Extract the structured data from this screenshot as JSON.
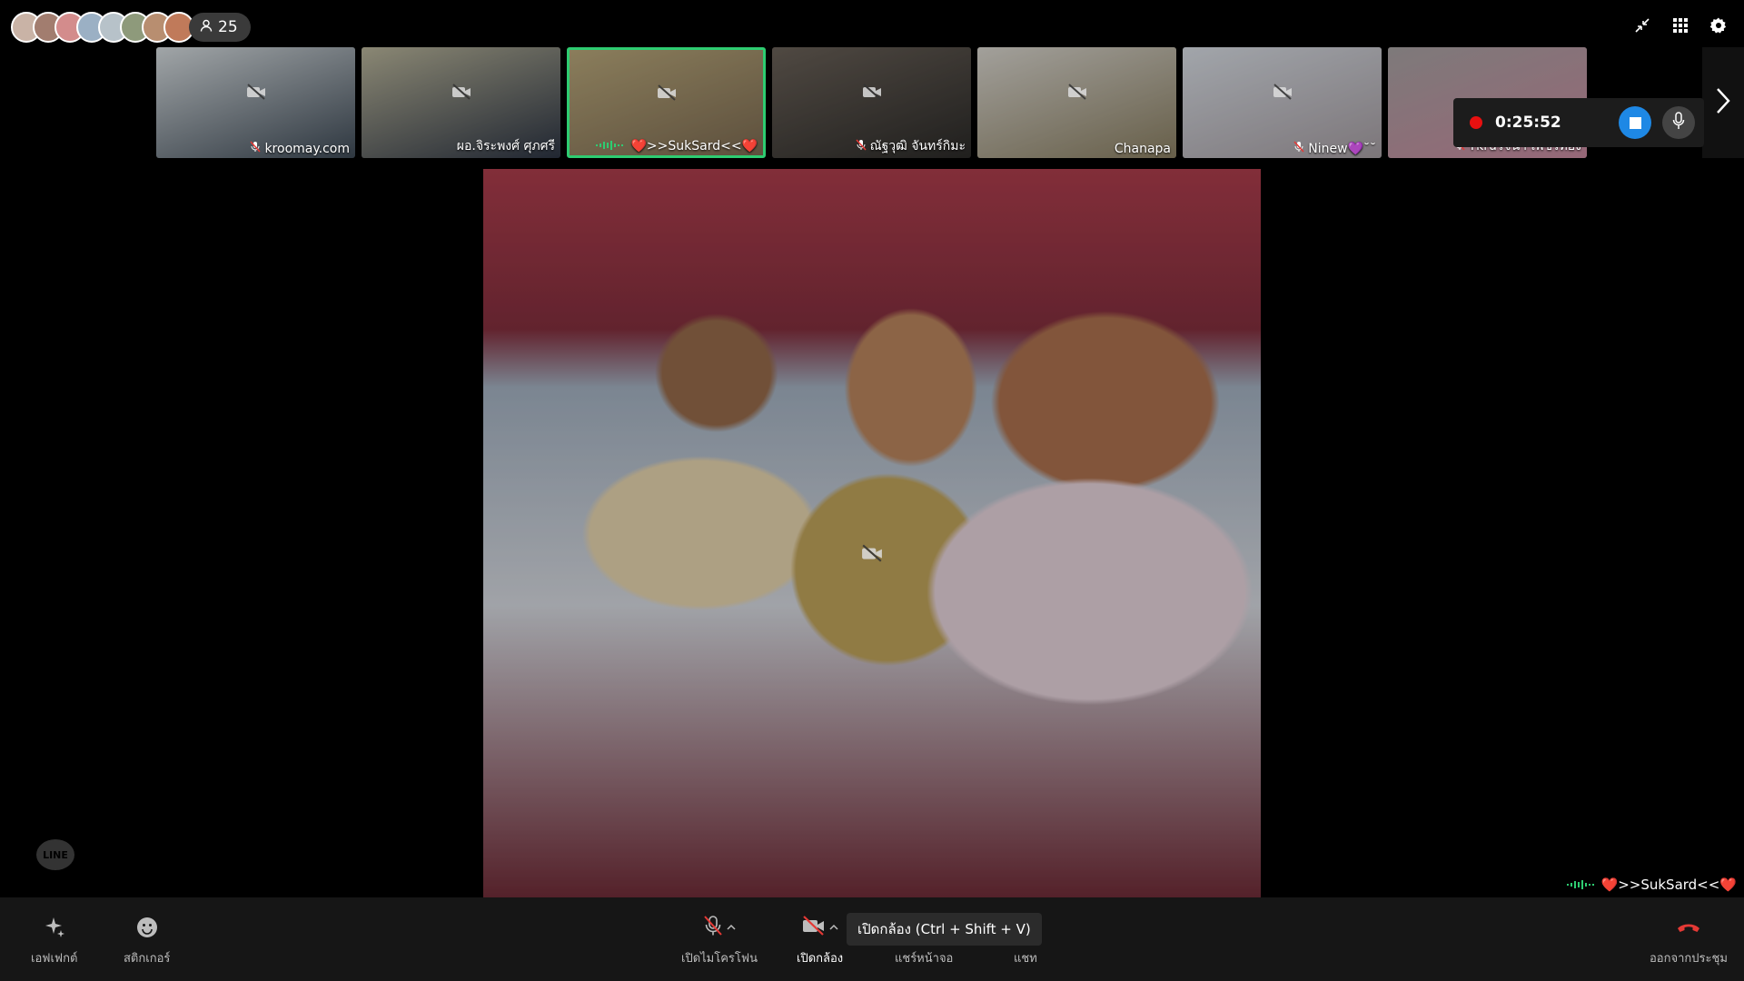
{
  "header": {
    "participant_count": "25",
    "avatar_colors": [
      "#c9b3a6",
      "#a27d6f",
      "#d38c8c",
      "#9bb0c4",
      "#b7c2c9",
      "#8e9a7b",
      "#b88e70",
      "#c07a5a"
    ]
  },
  "thumbnails": [
    {
      "name": "kroomay.com",
      "muted": true,
      "colors": [
        "#d7dde0",
        "#3e4a56"
      ]
    },
    {
      "name": "ผอ.จิระพงศ์ ศุภศรี",
      "muted": false,
      "colors": [
        "#b9b59b",
        "#2c3443"
      ]
    },
    {
      "name": "❤️>>SukSard<<❤️",
      "muted": false,
      "colors": [
        "#b9a87b",
        "#7d6b52"
      ]
    },
    {
      "name": "ณัฐวุฒิ จันทร์กิมะ",
      "muted": true,
      "colors": [
        "#6b6259",
        "#2b2a28"
      ]
    },
    {
      "name": "Chanapa",
      "muted": false,
      "colors": [
        "#d9d6cf",
        "#8a7f62"
      ]
    },
    {
      "name": "Ninew💜˘˘",
      "muted": true,
      "colors": [
        "#d8dde4",
        "#a69ea3"
      ]
    },
    {
      "name": "Tkruรจนา เพชรทอง",
      "muted": true,
      "colors": [
        "#a8a3a3",
        "#c98aa0"
      ]
    }
  ],
  "recording": {
    "time": "0:25:52"
  },
  "stage": {
    "speaker_label": "❤️>>SukSard<<❤️"
  },
  "badge": {
    "line": "LINE"
  },
  "toolbar": {
    "effects": "เอฟเฟกต์",
    "sticker": "สติกเกอร์",
    "mic": "เปิดไมโครโฟน",
    "camera": "เปิดกล้อง",
    "share": "แชร์หน้าจอ",
    "chat": "แชท",
    "leave": "ออกจากประชุม",
    "camera_tooltip": "เปิดกล้อง (Ctrl + Shift + V)"
  },
  "colors": {
    "active_border": "#2ecc71",
    "record_red": "#e81010",
    "stop_blue": "#1e88e5",
    "leave_red": "#e53935"
  }
}
